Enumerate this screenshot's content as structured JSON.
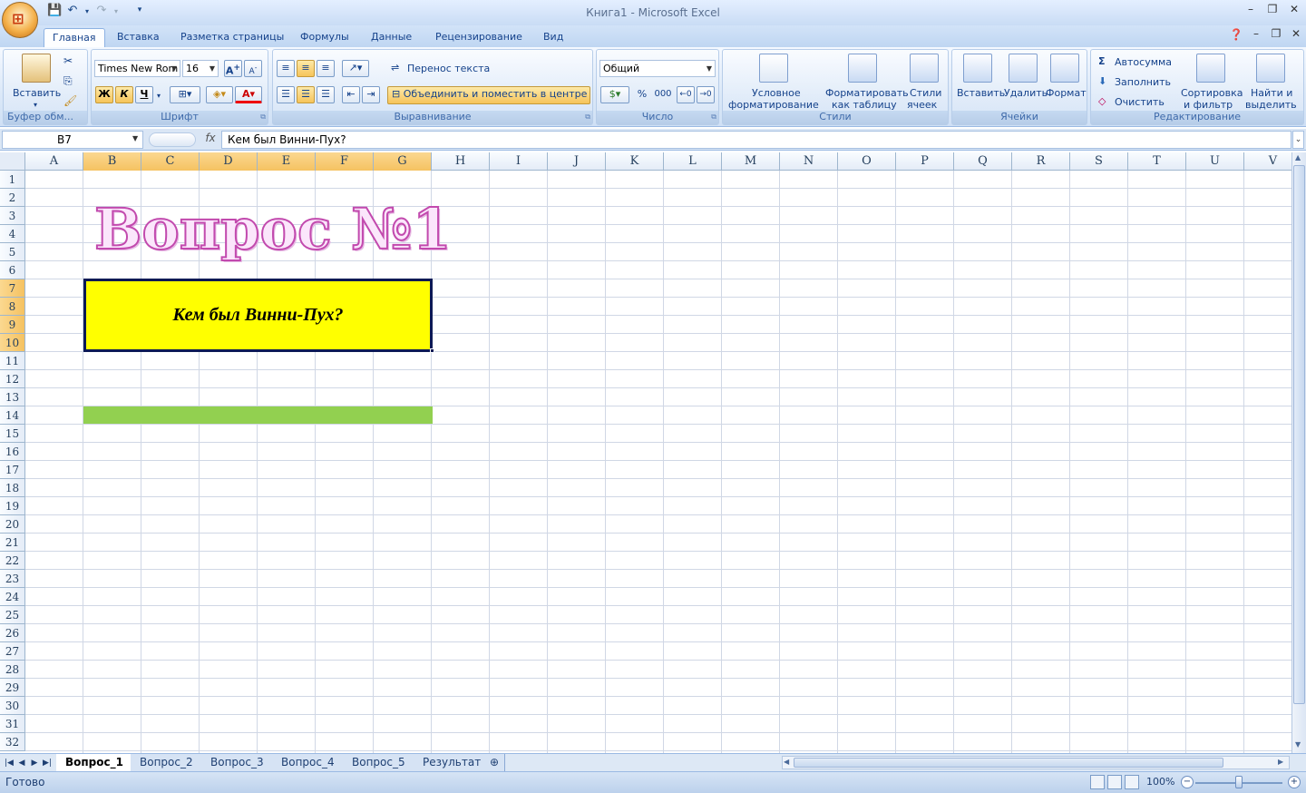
{
  "window": {
    "title": "Книга1 - Microsoft Excel"
  },
  "tabs": [
    "Главная",
    "Вставка",
    "Разметка страницы",
    "Формулы",
    "Данные",
    "Рецензирование",
    "Вид"
  ],
  "ribbon": {
    "clipboard": {
      "paste": "Вставить",
      "label": "Буфер обм..."
    },
    "font": {
      "name": "Times New Rom",
      "size": "16",
      "bold": "Ж",
      "italic": "К",
      "underline": "Ч",
      "label": "Шрифт"
    },
    "alignment": {
      "wrap": "Перенос текста",
      "merge": "Объединить и поместить в центре",
      "label": "Выравнивание"
    },
    "number": {
      "format": "Общий",
      "percent": "%",
      "thousands": "000",
      "label": "Число"
    },
    "styles": {
      "conditional": [
        "Условное",
        "форматирование"
      ],
      "table": [
        "Форматировать",
        "как таблицу"
      ],
      "cell": [
        "Стили",
        "ячеек"
      ],
      "label": "Стили"
    },
    "cells": {
      "insert": "Вставить",
      "delete": "Удалить",
      "format": "Формат",
      "label": "Ячейки"
    },
    "editing": {
      "autosum": "Автосумма",
      "fill": "Заполнить",
      "clear": "Очистить",
      "sort": [
        "Сортировка",
        "и фильтр"
      ],
      "find": [
        "Найти и",
        "выделить"
      ],
      "label": "Редактирование"
    }
  },
  "formula_bar": {
    "name_box": "B7",
    "fx": "fx",
    "content": "Кем был Винни-Пух?"
  },
  "columns": [
    "A",
    "B",
    "C",
    "D",
    "E",
    "F",
    "G",
    "H",
    "I",
    "J",
    "K",
    "L",
    "M",
    "N",
    "O",
    "P",
    "Q",
    "R",
    "S",
    "T",
    "U",
    "V"
  ],
  "selected_columns": [
    "B",
    "C",
    "D",
    "E",
    "F",
    "G"
  ],
  "rows": [
    1,
    2,
    3,
    4,
    5,
    6,
    7,
    8,
    9,
    10,
    11,
    12,
    13,
    14,
    15,
    16,
    17,
    18,
    19,
    20,
    21,
    22,
    23,
    24,
    25,
    26,
    27,
    28,
    29,
    30,
    31,
    32
  ],
  "selected_rows": [
    7,
    8,
    9,
    10
  ],
  "sheet": {
    "wordart": "Вопрос №1",
    "question": "Кем был Винни-Пух?",
    "colors": {
      "question_fill": "#ffff00",
      "bar_fill": "#92d050",
      "wordart_outline": "#c24aae"
    }
  },
  "sheet_tabs": [
    "Вопрос_1",
    "Вопрос_2",
    "Вопрос_3",
    "Вопрос_4",
    "Вопрос_5",
    "Результат"
  ],
  "active_sheet": "Вопрос_1",
  "status": {
    "text": "Готово",
    "zoom": "100%"
  }
}
